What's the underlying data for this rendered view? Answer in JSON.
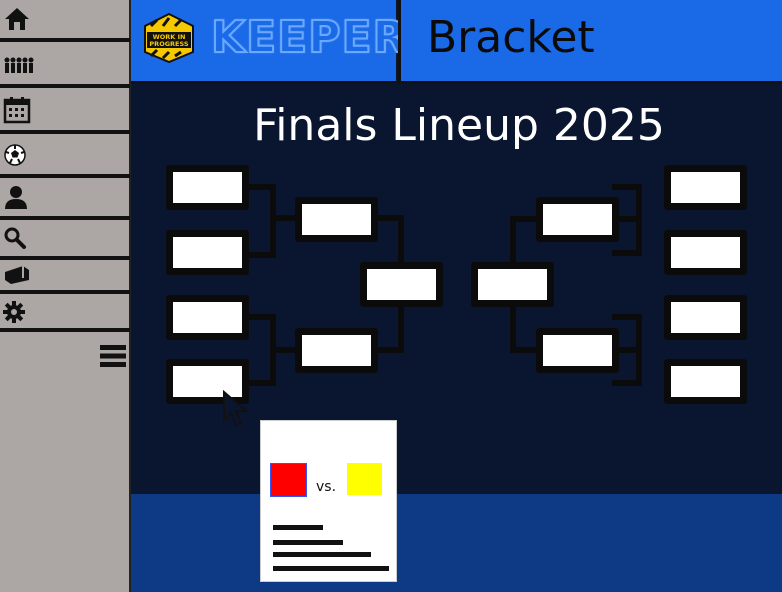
{
  "app": {
    "logo_badge": "WORK IN PROGRESS",
    "logo_text": "KEEPER",
    "page_header": "Bracket"
  },
  "sidebar": {
    "items": [
      {
        "icon": "home-icon"
      },
      {
        "icon": "team-icon"
      },
      {
        "icon": "calendar-icon"
      },
      {
        "icon": "soccer-ball-icon"
      },
      {
        "icon": "user-icon"
      },
      {
        "icon": "search-icon"
      },
      {
        "icon": "ticket-icon"
      },
      {
        "icon": "gear-icon"
      }
    ],
    "menu_icon": "menu-icon"
  },
  "bracket": {
    "title": "Finals Lineup 2025"
  },
  "matchup_card": {
    "vs_label": "vs.",
    "team_a_color": "#ff0000",
    "team_b_color": "#ffff00"
  },
  "colors": {
    "header_blue": "#1a6ae8",
    "background_navy": "#0a1530",
    "footer_blue": "#0e3a85",
    "sidebar_gray": "#aca6a5"
  }
}
